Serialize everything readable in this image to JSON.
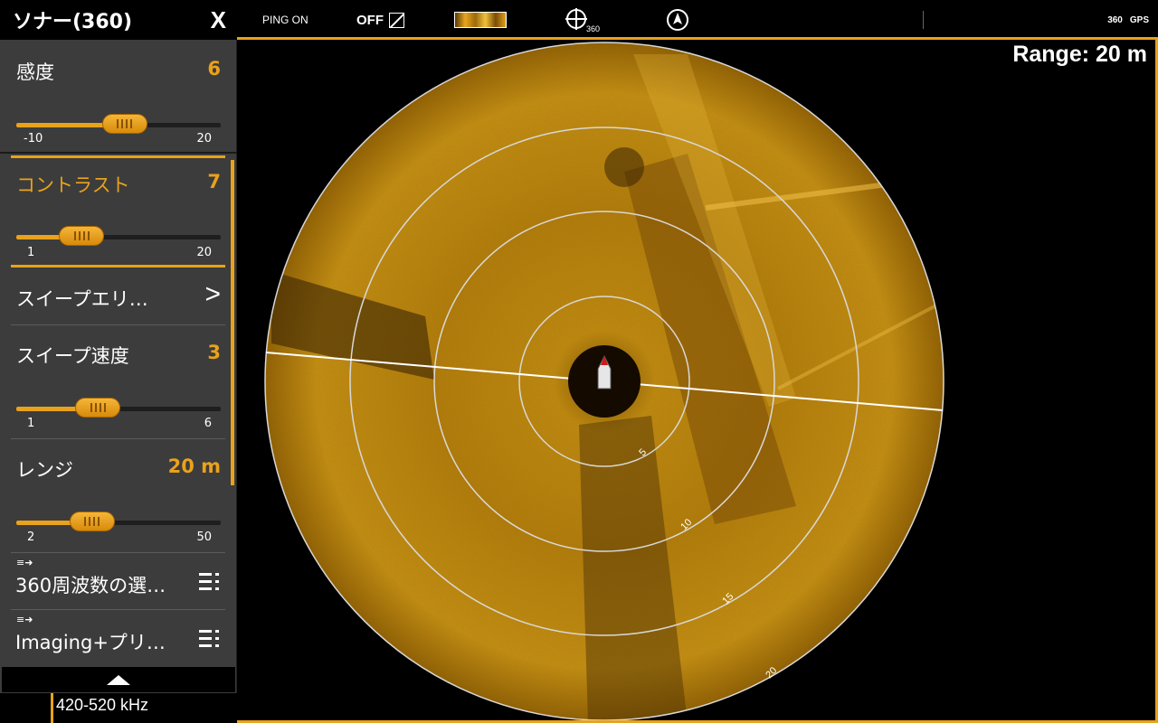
{
  "panel": {
    "title": "ソナー(360)",
    "close_label": "X",
    "sensitivity": {
      "label": "感度",
      "value": "6",
      "min": "-10",
      "max": "20",
      "level": 0.53
    },
    "contrast": {
      "label": "コントラスト",
      "value": "7",
      "min": "1",
      "max": "20",
      "level": 0.32
    },
    "sweep_area": {
      "label": "スイープエリ…",
      "chevron": ">"
    },
    "sweep_speed": {
      "label": "スイープ速度",
      "value": "3",
      "min": "1",
      "max": "6",
      "level": 0.4
    },
    "range": {
      "label": "レンジ",
      "value": "20 m",
      "min": "2",
      "max": "50",
      "level": 0.37
    },
    "frequency_select": {
      "label": "360周波数の選…"
    },
    "imaging": {
      "label": "Imaging+プリ…"
    }
  },
  "topbar": {
    "ping": "PING ON",
    "off": "OFF",
    "icon_360": "360",
    "icon_360_right": "360",
    "gps": "GPS"
  },
  "sonar": {
    "range_label": "Range: 20 m",
    "ring_labels": [
      "5",
      "10",
      "15",
      "20"
    ],
    "frequency": "420-520 kHz"
  },
  "colors": {
    "accent": "#e9a21b",
    "panel": "#3c3c3c",
    "sonar_base": "#b37a10"
  }
}
